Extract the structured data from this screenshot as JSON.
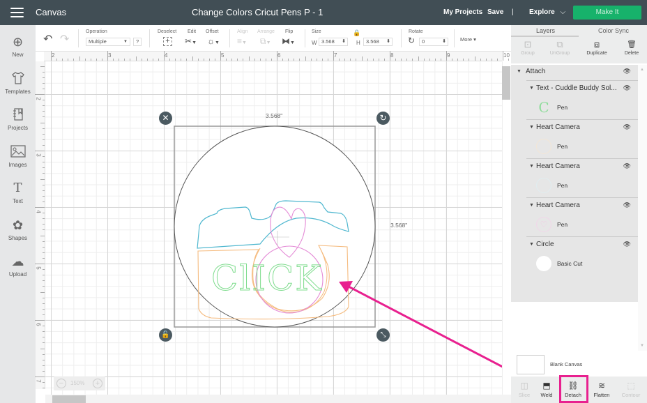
{
  "topbar": {
    "menu_icon": "hamburger-icon",
    "app_title": "Canvas",
    "doc_title": "Change Colors Cricut Pens P - 1",
    "my_projects": "My Projects",
    "save": "Save",
    "divider": "|",
    "explore": "Explore",
    "explore_chevron": "⌵",
    "make_it": "Make It"
  },
  "sidebar": {
    "items": [
      {
        "label": "New",
        "icon": "⊕"
      },
      {
        "label": "Templates",
        "icon": "👕"
      },
      {
        "label": "Projects",
        "icon": "⊟"
      },
      {
        "label": "Images",
        "icon": "⛰"
      },
      {
        "label": "Text",
        "icon": "T"
      },
      {
        "label": "Shapes",
        "icon": "✿"
      },
      {
        "label": "Upload",
        "icon": "☁"
      }
    ]
  },
  "toolbar": {
    "undo_icon": "↶",
    "redo_icon": "↷",
    "operation_label": "Operation",
    "operation_value": "Multiple",
    "operation_help": "?",
    "deselect_label": "Deselect",
    "edit_label": "Edit",
    "offset_label": "Offset",
    "align_label": "Align",
    "arrange_label": "Arrange",
    "flip_label": "Flip",
    "size_label": "Size",
    "w_label": "W",
    "w_value": "3.568",
    "h_label": "H",
    "h_value": "3.568",
    "rotate_label": "Rotate",
    "rotate_value": "0",
    "more_label": "More ▾"
  },
  "rulers": {
    "top": [
      "2",
      "3",
      "4",
      "5",
      "6",
      "7",
      "8",
      "9",
      "10"
    ],
    "left": [
      "2",
      "3",
      "4",
      "5",
      "6",
      "7"
    ]
  },
  "canvas": {
    "width_label": "3.568\"",
    "height_label": "3.568\"",
    "design_text": "ClICK",
    "zoom_value": "150%",
    "zoom_minus": "−",
    "zoom_plus": "+",
    "colors": {
      "camera_top": "#4fb7cf",
      "camera_body": "#f5bb7f",
      "heart_lens": "#e48ad6",
      "text": "#7edc8d",
      "circle": "#555555",
      "arrow": "#e8208f"
    }
  },
  "panel": {
    "tabs": [
      "Layers",
      "Color Sync"
    ],
    "tools": [
      {
        "label": "Group",
        "icon": "⊡",
        "enabled": false
      },
      {
        "label": "UnGroup",
        "icon": "⧉",
        "enabled": false
      },
      {
        "label": "Duplicate",
        "icon": "⧈",
        "enabled": true
      },
      {
        "label": "Delete",
        "icon": "🗑",
        "enabled": true
      }
    ],
    "layers": {
      "group_name": "Attach",
      "items": [
        {
          "name": "Text - Cuddle Buddy Sol...",
          "op": "Pen"
        },
        {
          "name": "Heart Camera",
          "op": "Pen"
        },
        {
          "name": "Heart Camera",
          "op": "Pen"
        },
        {
          "name": "Heart Camera",
          "op": "Pen"
        },
        {
          "name": "Circle",
          "op": "Basic Cut"
        }
      ]
    },
    "blank_canvas": "Blank Canvas",
    "bottom_tools": [
      {
        "label": "Slice",
        "icon": "◫",
        "enabled": false
      },
      {
        "label": "Weld",
        "icon": "⬒",
        "enabled": true
      },
      {
        "label": "Detach",
        "icon": "⛓",
        "enabled": true
      },
      {
        "label": "Flatten",
        "icon": "≋",
        "enabled": true
      },
      {
        "label": "Contour",
        "icon": "⬚",
        "enabled": false
      }
    ]
  }
}
